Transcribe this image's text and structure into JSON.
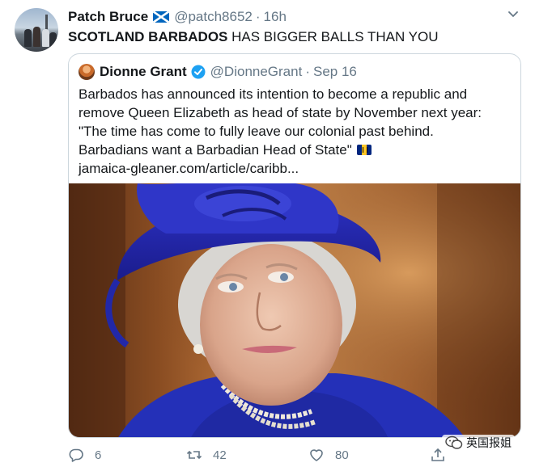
{
  "tweet": {
    "author_name": "Patch Bruce",
    "author_handle": "@patch8652",
    "separator": "·",
    "time": "16h",
    "text_bold": "SCOTLAND BARBADOS",
    "text_rest": " HAS BIGGER BALLS THAN YOU",
    "author_flag_icon": "scotland-flag-icon"
  },
  "quoted": {
    "author_name": "Dionne Grant",
    "author_handle": "@DionneGrant",
    "separator": "·",
    "date": "Sep 16",
    "lines": [
      "Barbados has announced its intention to become a republic and",
      "remove Queen Elizabeth as head of state by November next year:",
      "\"The time has come to fully leave our colonial past behind.",
      "Barbadians want a Barbadian Head of State\""
    ],
    "link": "jamaica-gleaner.com/article/caribb...",
    "flag_icon": "barbados-flag-icon",
    "verified_color": "#1da1f2"
  },
  "actions": {
    "reply_count": "6",
    "retweet_count": "42",
    "like_count": "80"
  },
  "watermark": {
    "text": "英国报姐"
  },
  "colors": {
    "text": "#14171a",
    "secondary": "#657786",
    "border": "#ccd6dd",
    "accent": "#1da1f2"
  }
}
